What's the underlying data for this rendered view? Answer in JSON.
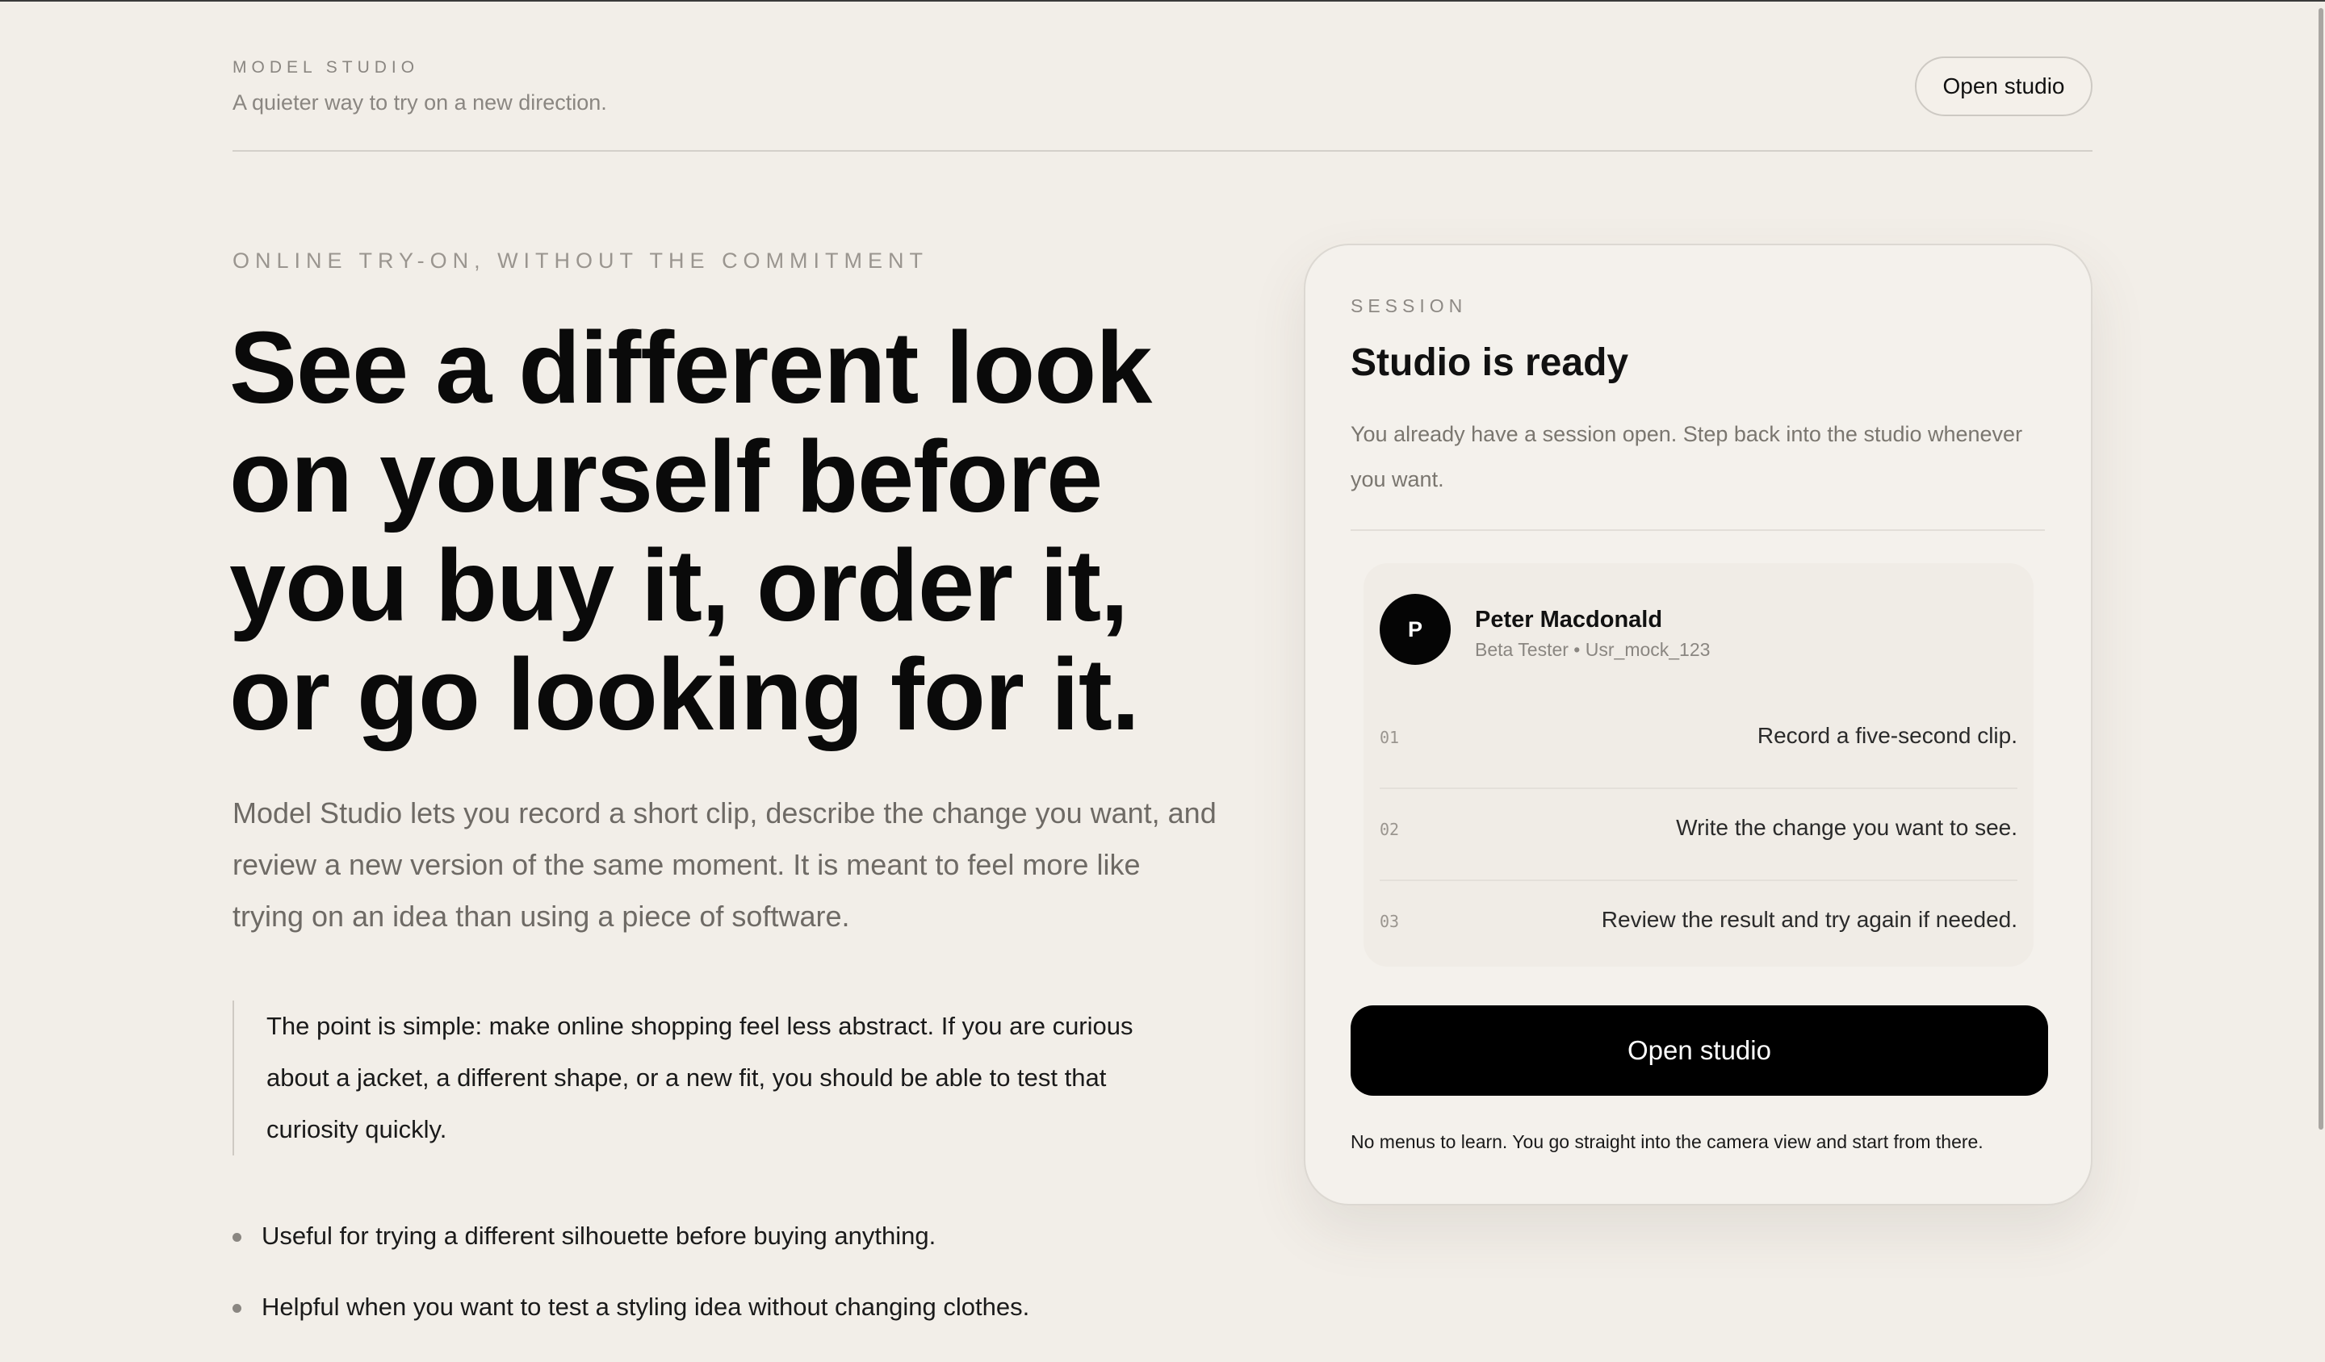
{
  "header": {
    "brand": "MODEL STUDIO",
    "tagline": "A quieter way to try on a new direction.",
    "open_studio_label": "Open studio"
  },
  "hero": {
    "eyebrow": "ONLINE TRY-ON, WITHOUT THE COMMITMENT",
    "headline_lines": [
      "See a different look",
      "on yourself before",
      "you buy it, order it,",
      "or go looking for it."
    ],
    "lede": "Model Studio lets you record a short clip, describe the change you want, and review a new version of the same moment. It is meant to feel more like trying on an idea than using a piece of software.",
    "quote": "The point is simple: make online shopping feel less abstract. If you are curious about a jacket, a different shape, or a new fit, you should be able to test that curiosity quickly.",
    "bullets": [
      "Useful for trying a different silhouette before buying anything.",
      "Helpful when you want to test a styling idea without changing clothes."
    ]
  },
  "session": {
    "label": "SESSION",
    "title": "Studio is ready",
    "description": "You already have a session open. Step back into the studio whenever you want.",
    "user": {
      "initial": "P",
      "name": "Peter Macdonald",
      "subtitle": "Beta Tester • Usr_mock_123"
    },
    "steps": [
      {
        "num": "01",
        "text": "Record a five-second clip."
      },
      {
        "num": "02",
        "text": "Write the change you want to see."
      },
      {
        "num": "03",
        "text": "Review the result and try again if needed."
      }
    ],
    "cta_label": "Open studio",
    "footnote": "No menus to learn. You go straight into the camera view and start from there."
  },
  "colors": {
    "background": "#f2eee8",
    "primary_button": "#000000",
    "muted_text": "#8a8681"
  }
}
